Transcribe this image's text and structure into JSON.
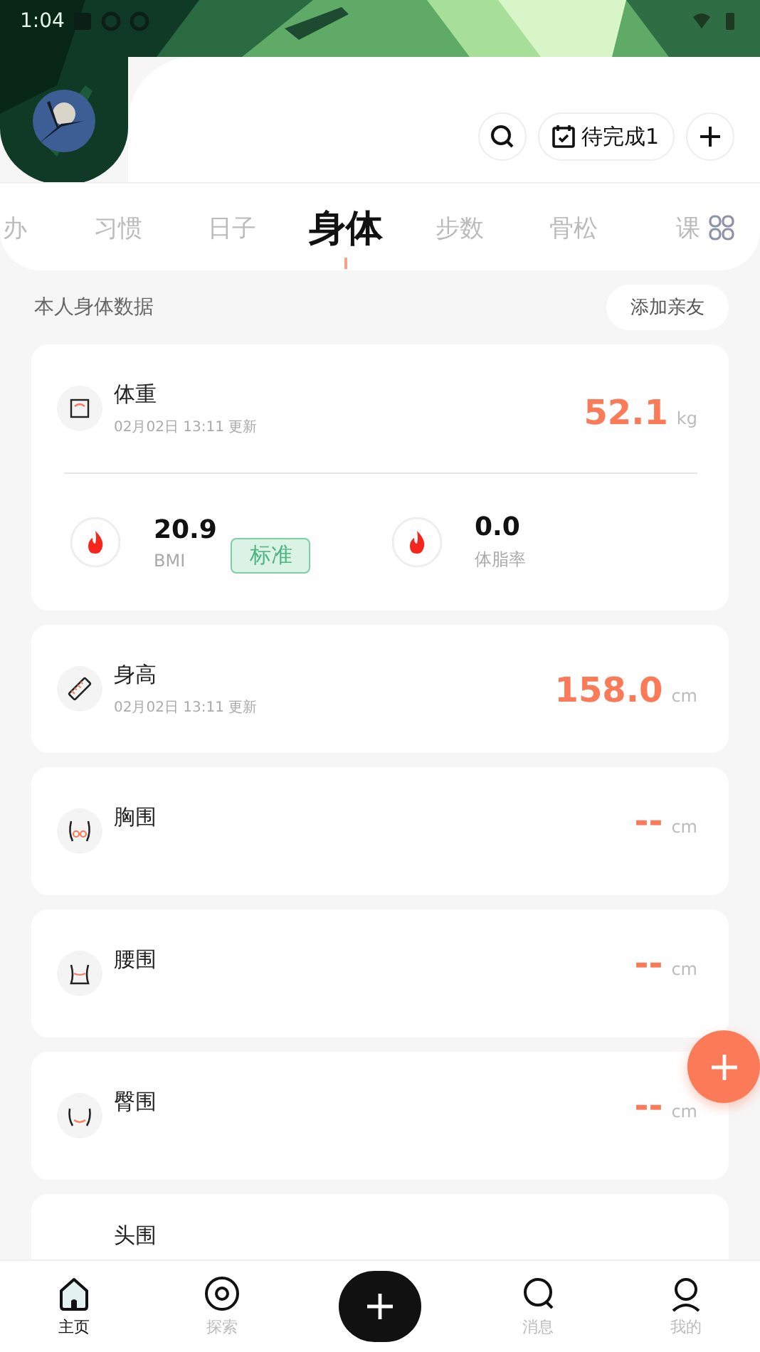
{
  "status_bar": {
    "time": "1:04"
  },
  "header": {
    "todo": {
      "label": "待完成1"
    }
  },
  "tabs": [
    {
      "label": "办",
      "selected": false
    },
    {
      "label": "习惯",
      "selected": false
    },
    {
      "label": "日子",
      "selected": false
    },
    {
      "label": "身体",
      "selected": true
    },
    {
      "label": "步数",
      "selected": false
    },
    {
      "label": "骨松",
      "selected": false
    },
    {
      "label": "课",
      "selected": false
    }
  ],
  "section": {
    "title": "本人身体数据",
    "button": "添加亲友"
  },
  "metrics": [
    {
      "kind": "detailed",
      "name": "体重",
      "updated": "02月02日 13:11 更新",
      "value": "52.1",
      "unit": "kg",
      "sub": [
        {
          "value": "20.9",
          "label": "BMI",
          "tag": "标准"
        },
        {
          "value": "0.0",
          "label": "体脂率"
        }
      ]
    },
    {
      "kind": "simple",
      "name": "身高",
      "updated": "02月02日 13:11 更新",
      "value": "158.0",
      "unit": "cm"
    },
    {
      "kind": "simple",
      "name": "胸围",
      "value": "--",
      "unit": "cm"
    },
    {
      "kind": "simple",
      "name": "腰围",
      "value": "--",
      "unit": "cm"
    },
    {
      "kind": "simple",
      "name": "臀围",
      "value": "--",
      "unit": "cm"
    },
    {
      "kind": "simple",
      "name": "头围"
    }
  ],
  "nav": [
    {
      "label": "主页",
      "selected": true
    },
    {
      "label": "探索",
      "selected": false
    },
    {
      "kind": "add"
    },
    {
      "label": "消息",
      "selected": false
    },
    {
      "label": "我的",
      "selected": false
    }
  ]
}
